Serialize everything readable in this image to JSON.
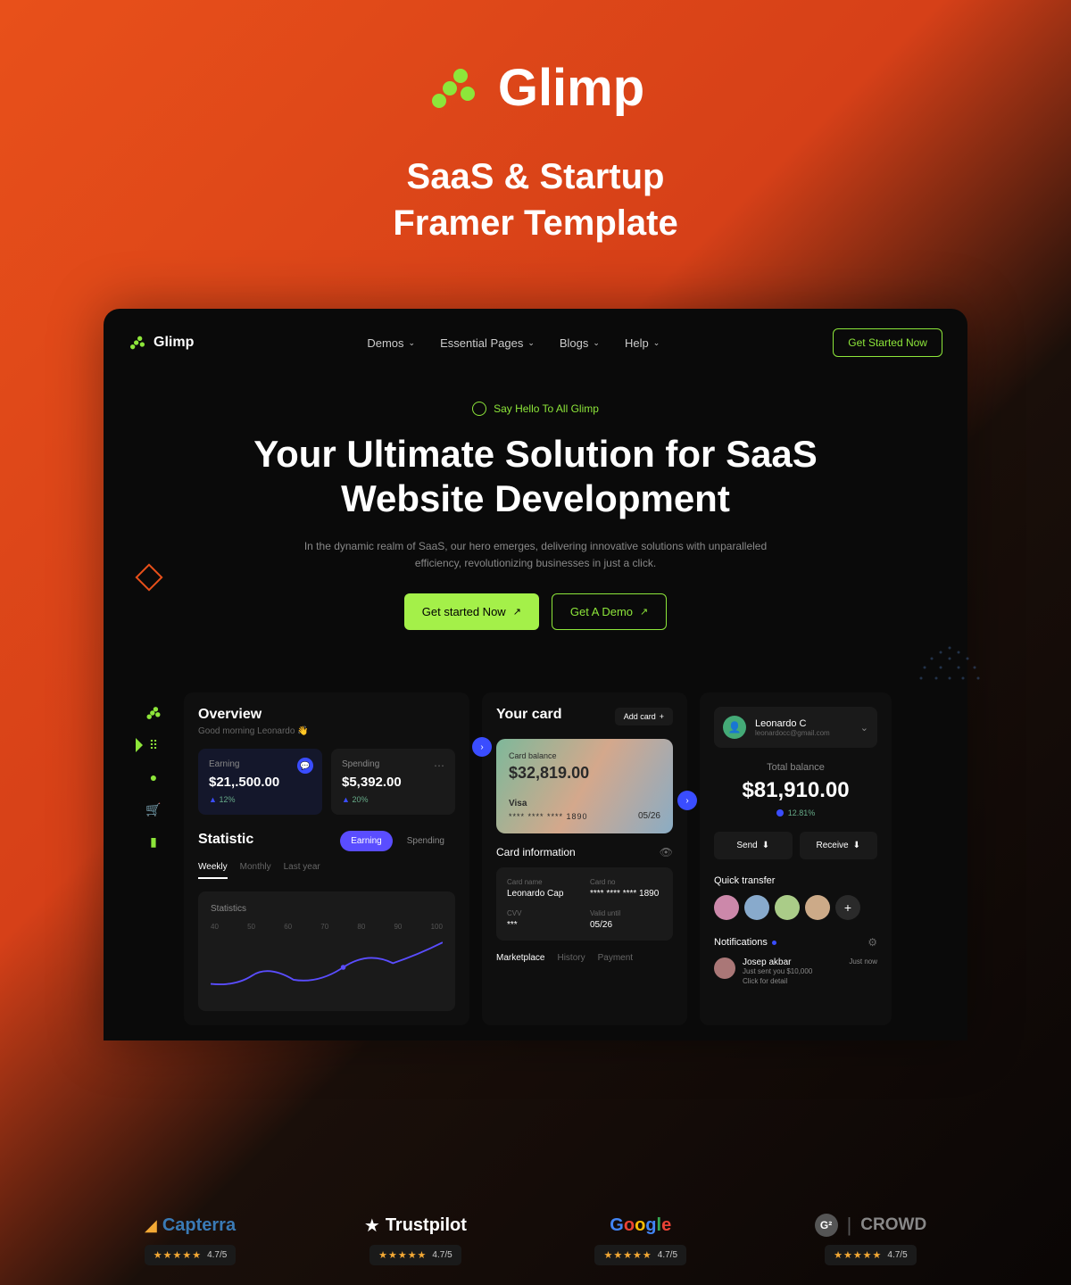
{
  "hero": {
    "brand": "Glimp",
    "tagline_line1": "SaaS & Startup",
    "tagline_line2": "Framer Template"
  },
  "nav": {
    "brand": "Glimp",
    "items": [
      "Demos",
      "Essential Pages",
      "Blogs",
      "Help"
    ],
    "cta": "Get Started Now"
  },
  "page": {
    "pill": "Say Hello To All Glimp",
    "title_line1": "Your Ultimate Solution for SaaS",
    "title_line2": "Website Development",
    "subtitle": "In the dynamic realm of SaaS, our hero emerges, delivering innovative solutions with unparalleled efficiency, revolutionizing businesses in just a click.",
    "btn_primary": "Get started  Now",
    "btn_outline": "Get A Demo"
  },
  "dashboard": {
    "overview": {
      "title": "Overview",
      "greeting": "Good morning Leonardo 👋",
      "earning": {
        "label": "Earning",
        "value": "$21,.500.00",
        "pct": "12%"
      },
      "spending": {
        "label": "Spending",
        "value": "$5,392.00",
        "pct": "20%"
      },
      "statistic_title": "Statistic",
      "tabs": [
        "Earning",
        "Spending"
      ],
      "time_tabs": [
        "Weekly",
        "Monthly",
        "Last year"
      ],
      "chart_label": "Statistics",
      "chart_axis": [
        "40",
        "50",
        "60",
        "70",
        "80",
        "90",
        "100"
      ]
    },
    "yourcard": {
      "title": "Your card",
      "add": "Add card",
      "balance_label": "Card balance",
      "balance": "$32,819.00",
      "brand": "Visa",
      "number": "**** **** **** 1890",
      "exp": "05/26",
      "info_title": "Card information",
      "info": {
        "name_label": "Card name",
        "name": "Leonardo Cap",
        "num_label": "Card no",
        "num": "**** **** **** 1890",
        "cvv_label": "CVV",
        "cvv": "***",
        "valid_label": "Valid until",
        "valid": "05/26"
      },
      "bottom_tabs": [
        "Marketplace",
        "History",
        "Payment"
      ]
    },
    "sidebar": {
      "user_name": "Leonardo C",
      "user_email": "leonardocc@gmail.com",
      "total_label": "Total balance",
      "total": "$81,910.00",
      "total_pct": "12.81%",
      "send": "Send",
      "receive": "Receive",
      "qt_title": "Quick transfer",
      "notif_title": "Notifications",
      "notif": {
        "name": "Josep akbar",
        "text": "Just sent you $10,000",
        "link": "Click for detail",
        "time": "Just now"
      }
    }
  },
  "reviews": {
    "capterra": {
      "brand": "Capterra",
      "score": "4.7/5"
    },
    "trustpilot": {
      "brand": "Trustpilot",
      "score": "4.7/5"
    },
    "google": {
      "brand": "Google",
      "score": "4.7/5"
    },
    "crowd": {
      "brand": "CROWD",
      "score": "4.7/5"
    }
  }
}
